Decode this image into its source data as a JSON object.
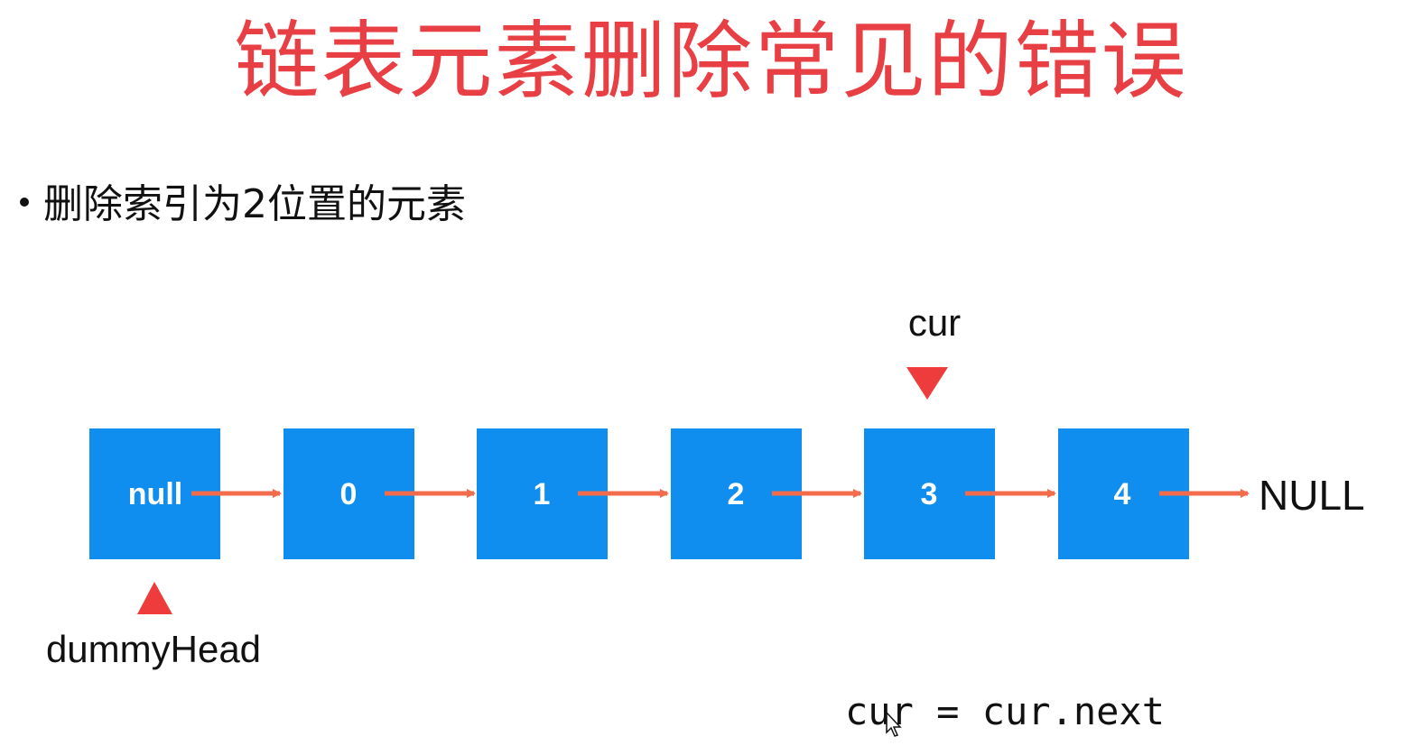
{
  "title": "链表元素删除常见的错误",
  "bullet": "删除索引为2位置的元素",
  "nodes": [
    "null",
    "0",
    "1",
    "2",
    "3",
    "4"
  ],
  "tail_label": "NULL",
  "cur_label": "cur",
  "dummy_label": "dummyHead",
  "code": "cur = cur.next",
  "colors": {
    "title": "#e83f44",
    "node_fill": "#0f8ef0",
    "arrow": "#f26b4b",
    "pointer": "#ee3b3b"
  }
}
